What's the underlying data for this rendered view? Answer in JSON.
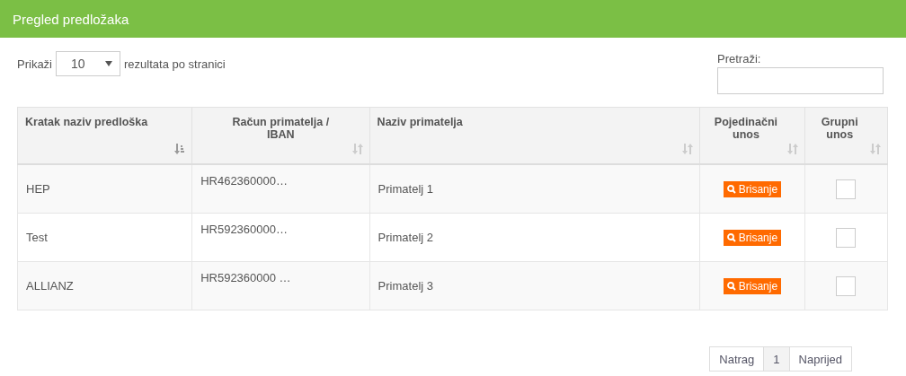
{
  "header": {
    "title": "Pregled predložaka"
  },
  "length_menu": {
    "label_before": "Prikaži",
    "value": "10",
    "label_after": "rezultata po stranici"
  },
  "search": {
    "label": "Pretraži:"
  },
  "table": {
    "columns": [
      {
        "label": "Kratak naziv predloška",
        "sorted": true
      },
      {
        "label": "Račun primatelja / IBAN",
        "sorted": false
      },
      {
        "label": "Naziv primatelja",
        "sorted": false
      },
      {
        "label": "Pojedinačni unos",
        "sorted": false
      },
      {
        "label": "Grupni unos",
        "sorted": false
      }
    ],
    "rows": [
      {
        "name": "HEP",
        "account": "HR462360000…",
        "recipient": "Primatelj 1",
        "action": "Brisanje",
        "checked": false
      },
      {
        "name": "Test",
        "account": "HR592360000…",
        "recipient": "Primatelj 2",
        "action": "Brisanje",
        "checked": false
      },
      {
        "name": "ALLIANZ",
        "account": "HR592360000 …",
        "recipient": "Primatelj 3",
        "action": "Brisanje",
        "checked": false
      }
    ]
  },
  "pagination": [
    {
      "label": "Natrag",
      "selected": false
    },
    {
      "label": "1",
      "selected": true
    },
    {
      "label": "Naprijed",
      "selected": false
    }
  ]
}
